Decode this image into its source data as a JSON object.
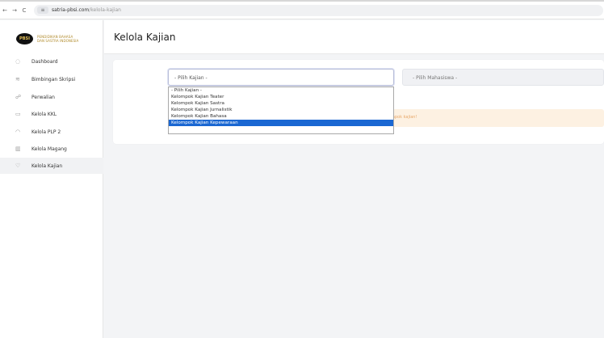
{
  "browser": {
    "back": "←",
    "forward": "→",
    "reload": "C",
    "site_icon": "≡",
    "url_host": "satria-pbsi.com",
    "url_path": "/kelola-kajian"
  },
  "sidebar": {
    "logo_mark": "PBSI",
    "logo_line1": "PENDIDIKAN BAHASA",
    "logo_line2": "DAN SASTRA INDONESIA",
    "items": [
      {
        "label": "Dashboard",
        "icon": "◌"
      },
      {
        "label": "Bimbingan Skripsi",
        "icon": "≋"
      },
      {
        "label": "Perwalian",
        "icon": "☍"
      },
      {
        "label": "Kelola KKL",
        "icon": "▭"
      },
      {
        "label": "Kelola PLP 2",
        "icon": "◠"
      },
      {
        "label": "Kelola Magang",
        "icon": "▥"
      },
      {
        "label": "Kelola Kajian",
        "icon": "♡"
      }
    ]
  },
  "header": {
    "title": "Kelola Kajian"
  },
  "form": {
    "kajian_selected": "- Pilih Kajian -",
    "mahasiswa_placeholder": "- Pilih Mahasiswa -",
    "dropdown_options": [
      "- Pilih Kajian -",
      "Kelompok Kajian Teater",
      "Kelompok Kajian Sastra",
      "Kelompok Kajian Jurnalistik",
      "Kelompok Kajian Bahasa",
      "Kelompok Kajian Kepewaraan"
    ],
    "highlighted_option": "Kelompok Kajian Kepewaraan"
  },
  "alert": {
    "text": "mpok kajian!"
  },
  "colors": {
    "highlight": "#1a67d2",
    "alert_bg": "#fdf1e2",
    "alert_text": "#e8a86a"
  }
}
